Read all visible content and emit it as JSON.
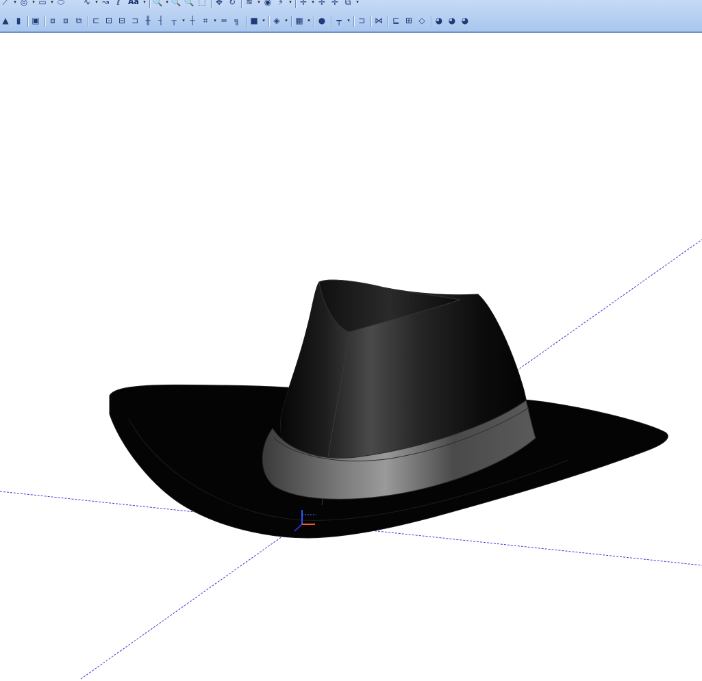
{
  "toolbar": {
    "row1": [
      {
        "name": "line-tool-icon",
        "glyph": "⟋"
      },
      {
        "name": "dropdown-arrow",
        "glyph": "▾",
        "drop": true
      },
      {
        "name": "circle-tool-icon",
        "glyph": "◎"
      },
      {
        "name": "dropdown-arrow",
        "glyph": "▾",
        "drop": true
      },
      {
        "name": "rectangle-tool-icon",
        "glyph": "▭"
      },
      {
        "name": "dropdown-arrow",
        "glyph": "▾",
        "drop": true
      },
      {
        "name": "ellipse-tool-icon",
        "glyph": "⬭"
      },
      {
        "name": "arc-tool-icon",
        "glyph": "⌒"
      },
      {
        "name": "spline-tool-icon",
        "glyph": "∿"
      },
      {
        "name": "dropdown-arrow",
        "glyph": "▾",
        "drop": true
      },
      {
        "name": "curve-tool-icon",
        "glyph": "↝"
      },
      {
        "name": "helix-tool-icon",
        "glyph": "ℓ"
      },
      {
        "name": "text-tool-button",
        "glyph": "Aa",
        "text": true
      },
      {
        "name": "dropdown-arrow",
        "glyph": "▾",
        "drop": true
      },
      {
        "name": "sep"
      },
      {
        "name": "zoom-icon",
        "glyph": "🔍"
      },
      {
        "name": "dropdown-arrow",
        "glyph": "▾",
        "drop": true
      },
      {
        "name": "zoom-out-icon",
        "glyph": "🔍"
      },
      {
        "name": "zoom-in-icon",
        "glyph": "🔍"
      },
      {
        "name": "zoom-window-icon",
        "glyph": "⬚"
      },
      {
        "name": "sep"
      },
      {
        "name": "pan-icon",
        "glyph": "✥"
      },
      {
        "name": "rotate-icon",
        "glyph": "↻"
      },
      {
        "name": "sep"
      },
      {
        "name": "layer-icon",
        "glyph": "≋"
      },
      {
        "name": "dropdown-arrow",
        "glyph": "▾",
        "drop": true
      },
      {
        "name": "view-icon",
        "glyph": "◉"
      },
      {
        "name": "sketch-icon",
        "glyph": "⚡"
      },
      {
        "name": "dropdown-arrow",
        "glyph": "▾",
        "drop": true
      },
      {
        "name": "sep"
      },
      {
        "name": "move-icon",
        "glyph": "✛"
      },
      {
        "name": "dropdown-arrow",
        "glyph": "▾",
        "drop": true
      },
      {
        "name": "copy-icon",
        "glyph": "✛"
      },
      {
        "name": "mirror-icon",
        "glyph": "✛"
      },
      {
        "name": "section-view-icon",
        "glyph": "⧉"
      },
      {
        "name": "dropdown-arrow",
        "glyph": "▾",
        "drop": true
      }
    ],
    "row2": [
      {
        "name": "cone-icon",
        "glyph": "▲"
      },
      {
        "name": "cylinder-icon",
        "glyph": "▮"
      },
      {
        "name": "sep"
      },
      {
        "name": "box-icon",
        "glyph": "▣"
      },
      {
        "name": "sep"
      },
      {
        "name": "boolean-union-icon",
        "glyph": "⧈"
      },
      {
        "name": "boolean-subtract-icon",
        "glyph": "⧈"
      },
      {
        "name": "boolean-intersect-icon",
        "glyph": "⧉"
      },
      {
        "name": "sep"
      },
      {
        "name": "align-left-icon",
        "glyph": "⊏"
      },
      {
        "name": "align-center-icon",
        "glyph": "⊡"
      },
      {
        "name": "align-middle-icon",
        "glyph": "⊟"
      },
      {
        "name": "align-right-icon",
        "glyph": "⊐"
      },
      {
        "name": "constraint-parallel-icon",
        "glyph": "╫"
      },
      {
        "name": "constraint-perpendicular-icon",
        "glyph": "┤"
      },
      {
        "name": "constraint-tangent-icon",
        "glyph": "┬"
      },
      {
        "name": "dropdown-arrow",
        "glyph": "▾",
        "drop": true
      },
      {
        "name": "constraint-coincident-icon",
        "glyph": "┼"
      },
      {
        "name": "constraint-equal-icon",
        "glyph": "⌗"
      },
      {
        "name": "dropdown-arrow",
        "glyph": "▾",
        "drop": true
      },
      {
        "name": "constraint-horizontal-icon",
        "glyph": "═"
      },
      {
        "name": "constraint-vertical-icon",
        "glyph": "╗"
      },
      {
        "name": "sep"
      },
      {
        "name": "solid-shading-icon",
        "glyph": "■"
      },
      {
        "name": "dropdown-arrow",
        "glyph": "▾",
        "drop": true
      },
      {
        "name": "sep"
      },
      {
        "name": "material-icon",
        "glyph": "◈"
      },
      {
        "name": "dropdown-arrow",
        "glyph": "▾",
        "drop": true
      },
      {
        "name": "sep"
      },
      {
        "name": "texture-icon",
        "glyph": "▦"
      },
      {
        "name": "dropdown-arrow",
        "glyph": "▾",
        "drop": true
      },
      {
        "name": "sep"
      },
      {
        "name": "light-icon",
        "glyph": "●"
      },
      {
        "name": "sep"
      },
      {
        "name": "measure-icon",
        "glyph": "┯"
      },
      {
        "name": "dropdown-arrow",
        "glyph": "▾",
        "drop": true
      },
      {
        "name": "sep"
      },
      {
        "name": "dimension-icon",
        "glyph": "⊐"
      },
      {
        "name": "sep"
      },
      {
        "name": "loft-icon",
        "glyph": "⋈"
      },
      {
        "name": "sep"
      },
      {
        "name": "shell-icon",
        "glyph": "⊑"
      },
      {
        "name": "offset-icon",
        "glyph": "⊞"
      },
      {
        "name": "fillet-icon",
        "glyph": "◇"
      },
      {
        "name": "sep"
      },
      {
        "name": "render-icon",
        "glyph": "◕"
      },
      {
        "name": "render-region-icon",
        "glyph": "◕"
      },
      {
        "name": "render-stop-icon",
        "glyph": "◕"
      }
    ]
  },
  "scene": {
    "background": "#ffffff",
    "axis_color": "#3a3ad6",
    "hat_color": "#050505",
    "band_color": "#6d6d6d"
  }
}
